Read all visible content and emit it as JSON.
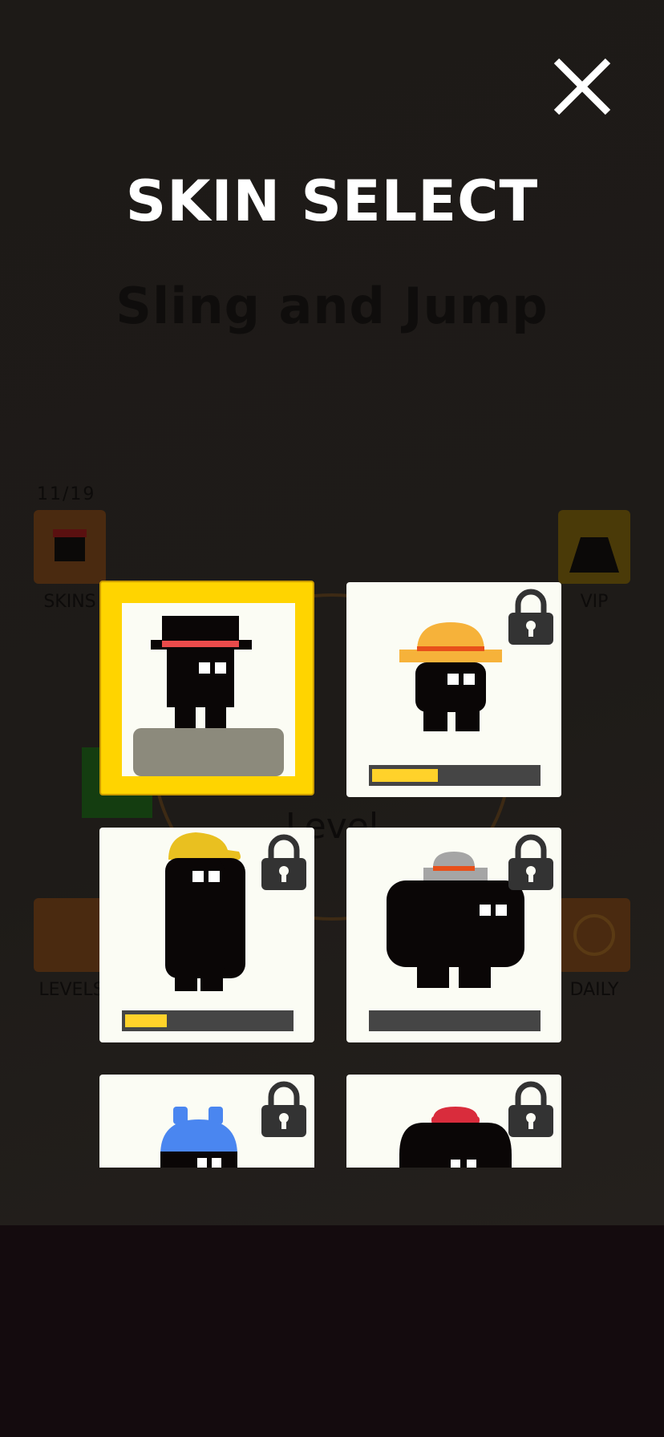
{
  "screen": {
    "title": "SKIN SELECT",
    "close_icon": "close-icon"
  },
  "background": {
    "game_title": "Sling and Jump",
    "skin_count": "11/19",
    "skins_label": "SKINS",
    "vip_label": "VIP",
    "levels_label": "LEVELS",
    "daily_label": "DAILY",
    "level_label": "Level"
  },
  "skins": [
    {
      "id": "top-hat",
      "selected": true,
      "locked": false,
      "progress": null,
      "hat_color": "#000000",
      "band_color": "#ea4b4b"
    },
    {
      "id": "straw-hat",
      "selected": false,
      "locked": true,
      "progress": 0.4,
      "hat_color": "#f6b23a",
      "band_color": "#e8501a"
    },
    {
      "id": "yellow-cap",
      "selected": false,
      "locked": true,
      "progress": 0.25,
      "hat_color": "#e9c020"
    },
    {
      "id": "gray-bowler",
      "selected": false,
      "locked": true,
      "progress": 0.0,
      "hat_color": "#a5a5a5",
      "band_color": "#e8501a"
    },
    {
      "id": "blue-helmet",
      "selected": false,
      "locked": true,
      "progress": null,
      "hat_color": "#4a86f0"
    },
    {
      "id": "red-beret",
      "selected": false,
      "locked": true,
      "progress": null,
      "hat_color": "#d92c3c"
    }
  ],
  "colors": {
    "selected_frame": "#ffd400",
    "progress_fill": "#ffd22a",
    "progress_track": "#454545",
    "lock": "#333333"
  }
}
